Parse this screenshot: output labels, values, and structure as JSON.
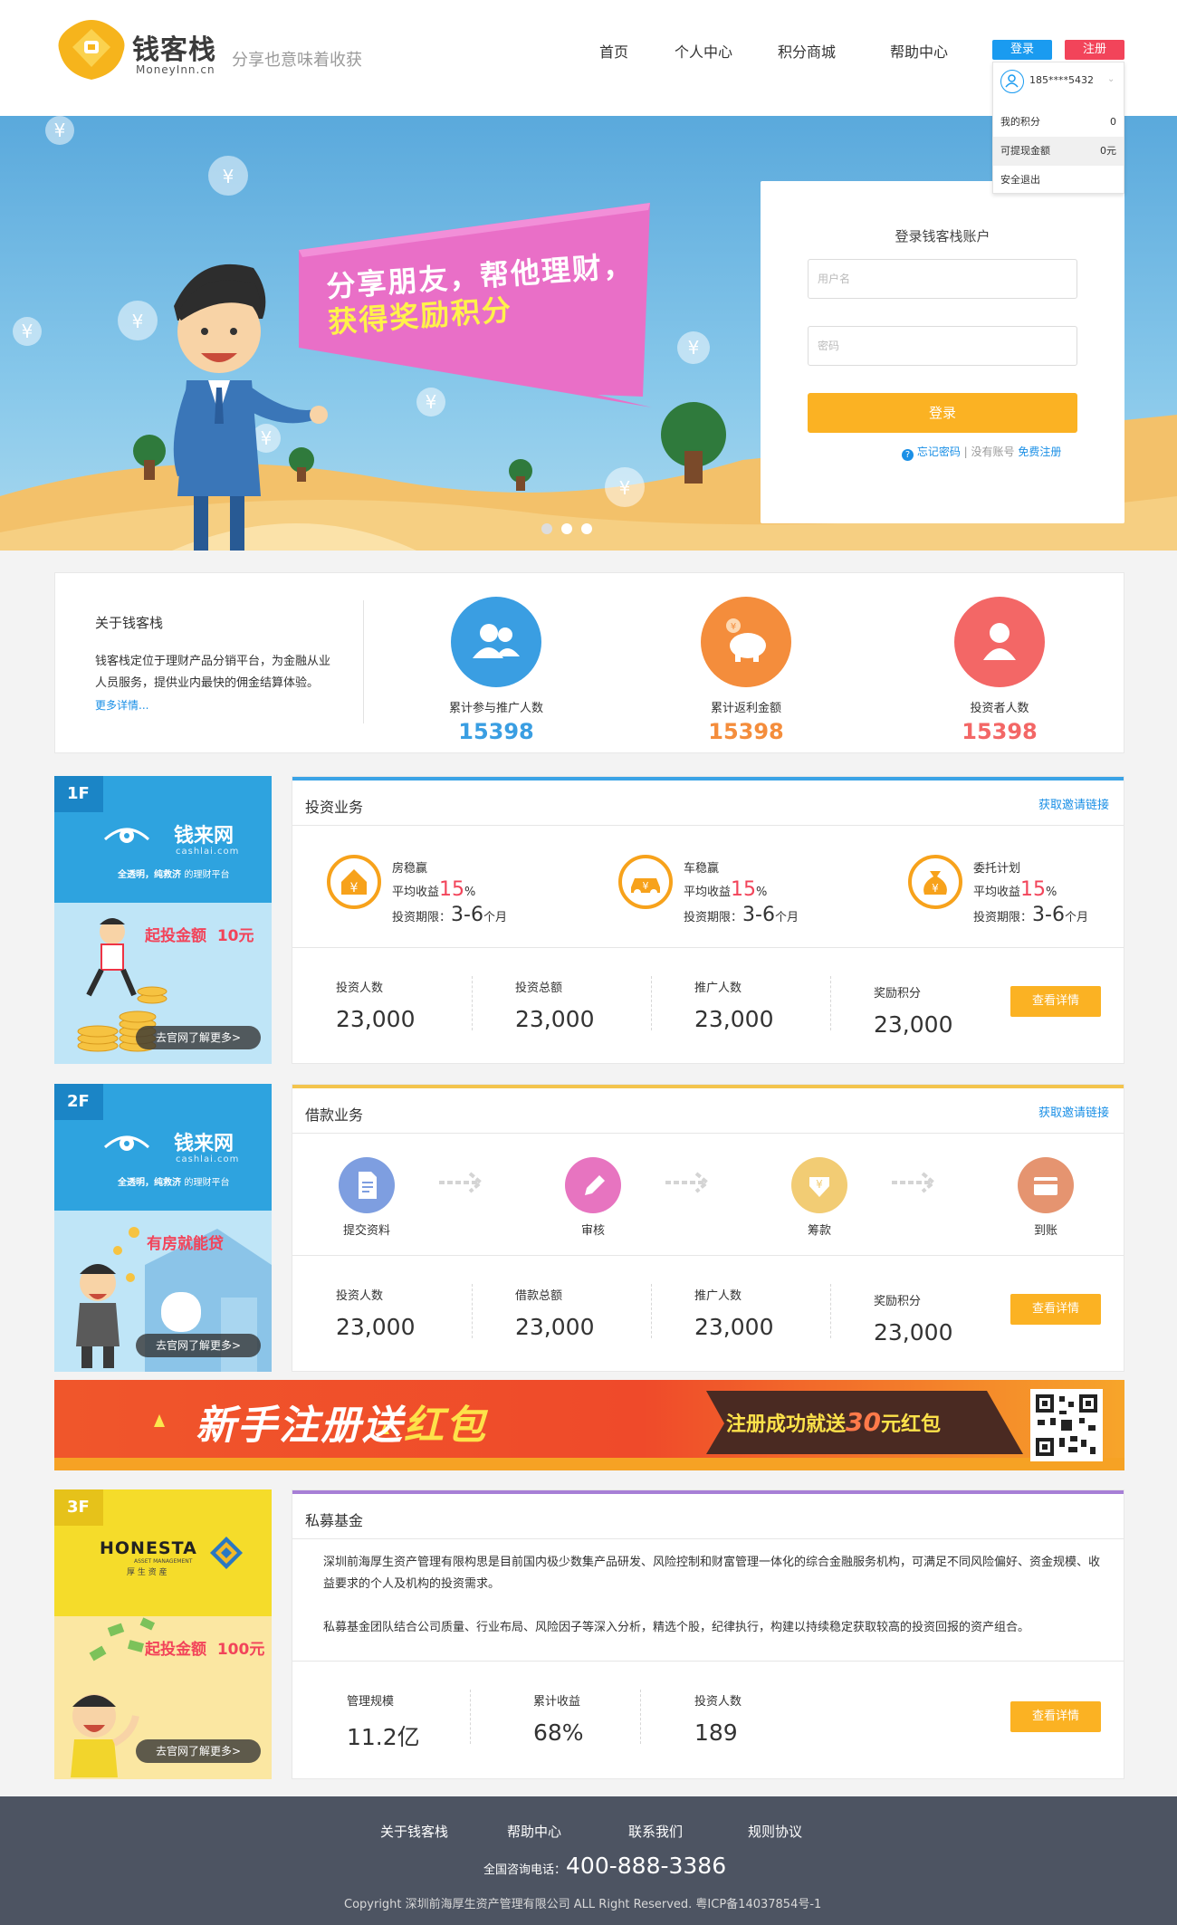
{
  "header": {
    "logo_cn": "钱客栈",
    "logo_en": "MoneyInn.cn",
    "slogan": "分享也意味着收获",
    "nav": [
      "首页",
      "个人中心",
      "积分商城",
      "帮助中心"
    ],
    "login_label": "登录",
    "register_label": "注册"
  },
  "user_dropdown": {
    "phone": "185****5432",
    "rows": [
      {
        "label": "我的积分",
        "value": "0"
      },
      {
        "label": "可提现金额",
        "value": "0元"
      },
      {
        "label": "安全退出",
        "value": ""
      }
    ]
  },
  "banner": {
    "headline_line1": "分享朋友，帮他理财，",
    "headline_line2": "获得奖励积分",
    "login_title": "登录钱客栈账户",
    "username_placeholder": "用户名",
    "password_placeholder": "密码",
    "login_button": "登录",
    "forgot": "忘记密码",
    "separator": "|",
    "no_account": "没有账号",
    "free_register": "免费注册"
  },
  "about": {
    "title": "关于钱客栈",
    "text": "钱客栈定位于理财产品分销平台，为金融从业人员服务，提供业内最快的佣金结算体验。",
    "more": "更多详情...",
    "stats": [
      {
        "label": "累计参与推广人数",
        "value": "15398",
        "color": "#3a9ee2"
      },
      {
        "label": "累计返利金额",
        "value": "15398",
        "color": "#f48d3c"
      },
      {
        "label": "投资者人数",
        "value": "15398",
        "color": "#f36766"
      }
    ]
  },
  "floors": [
    {
      "badge": "1F",
      "brand": "钱来网",
      "brand_en": "cashlai.com",
      "tagline": "全透明，纯救济",
      "tagline2": "的理财平台",
      "promo": "起投金额",
      "promo_amount": "10元",
      "cta": "去官网了解更多>",
      "title": "投资业务",
      "link": "获取邀请链接",
      "accent": "#3aa3e6",
      "products": [
        {
          "name": "房稳赢",
          "rate_label": "平均收益",
          "rate": "15",
          "rate_unit": "%",
          "term_label": "投资期限：",
          "term": "3-6",
          "term_unit": "个月"
        },
        {
          "name": "车稳赢",
          "rate_label": "平均收益",
          "rate": "15",
          "rate_unit": "%",
          "term_label": "投资期限：",
          "term": "3-6",
          "term_unit": "个月"
        },
        {
          "name": "委托计划",
          "rate_label": "平均收益",
          "rate": "15",
          "rate_unit": "%",
          "term_label": "投资期限：",
          "term": "3-6",
          "term_unit": "个月"
        }
      ],
      "stats": [
        {
          "label": "投资人数",
          "value": "23,000"
        },
        {
          "label": "投资总额",
          "value": "23,000"
        },
        {
          "label": "推广人数",
          "value": "23,000"
        },
        {
          "label": "奖励积分",
          "value": "23,000"
        }
      ],
      "detail_button": "查看详情"
    },
    {
      "badge": "2F",
      "brand": "钱来网",
      "brand_en": "cashlai.com",
      "tagline": "全透明，纯救济",
      "tagline2": "的理财平台",
      "promo": "有房就能贷",
      "cta": "去官网了解更多>",
      "title": "借款业务",
      "link": "获取邀请链接",
      "accent": "#f3c44c",
      "steps": [
        "提交资料",
        "审核",
        "筹款",
        "到账"
      ],
      "stats": [
        {
          "label": "投资人数",
          "value": "23,000"
        },
        {
          "label": "借款总额",
          "value": "23,000"
        },
        {
          "label": "推广人数",
          "value": "23,000"
        },
        {
          "label": "奖励积分",
          "value": "23,000"
        }
      ],
      "detail_button": "查看详情"
    },
    {
      "badge": "3F",
      "brand": "HONESTA",
      "brand_sub": "ASSET MANAGEMENT",
      "brand_cn": "厚 生 资 産",
      "promo": "起投金额",
      "promo_amount": "100元",
      "cta": "去官网了解更多>",
      "title": "私募基金",
      "accent": "#a77fd6",
      "paragraph1": "深圳前海厚生资产管理有限构思是目前国内极少数集产品研发、风险控制和财富管理一体化的综合金融服务机构，可满足不同风险偏好、资金规模、收益要求的个人及机构的投资需求。",
      "paragraph2": "私募基金团队结合公司质量、行业布局、风险因子等深入分析，精选个股，纪律执行，构建以持续稳定获取较高的投资回报的资产组合。",
      "stats": [
        {
          "label": "管理规模",
          "value": "11.2亿"
        },
        {
          "label": "累计收益",
          "value": "68%"
        },
        {
          "label": "投资人数",
          "value": "189"
        }
      ],
      "detail_button": "查看详情"
    }
  ],
  "promo_banner": {
    "left_a": "新手注册送",
    "left_b": "红包",
    "right_a": "注册成功就送",
    "right_amount": "30",
    "right_b": "元红包"
  },
  "footer": {
    "links": [
      "关于钱客栈",
      "帮助中心",
      "联系我们",
      "规则协议"
    ],
    "phone_label": "全国咨询电话：",
    "phone": "400-888-3386",
    "copyright": "Copyright  深圳前海厚生资产管理有限公司  ALL Right Reserved. 粤ICP备14037854号-1"
  }
}
